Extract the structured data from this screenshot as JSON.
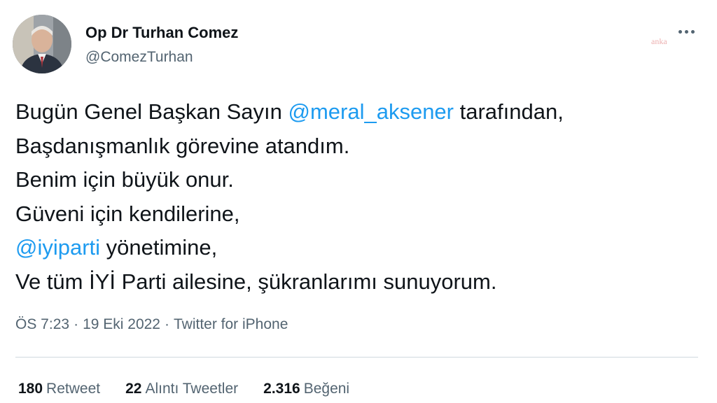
{
  "user": {
    "display_name": "Op Dr Turhan Comez",
    "handle": "@ComezTurhan"
  },
  "watermark": "anka",
  "tweet": {
    "lines": [
      {
        "before": "Bugün Genel Başkan Sayın ",
        "mention": "@meral_aksener",
        "after": " tarafından,"
      },
      {
        "text": "Başdanışmanlık görevine atandım."
      },
      {
        "text": "Benim için büyük onur."
      },
      {
        "text": "Güveni için kendilerine,"
      },
      {
        "mention": "@iyiparti",
        "after": " yönetimine,"
      },
      {
        "text": "Ve tüm İYİ Parti ailesine, şükranlarımı sunuyorum."
      }
    ]
  },
  "meta": {
    "time": "ÖS 7:23",
    "separator": "·",
    "date": "19 Eki 2022",
    "source": "Twitter for iPhone"
  },
  "stats": {
    "retweets": {
      "count": "180",
      "label": "Retweet"
    },
    "quotes": {
      "count": "22",
      "label": "Alıntı Tweetler"
    },
    "likes": {
      "count": "2.316",
      "label": "Beğeni"
    }
  },
  "colors": {
    "mention": "#1d9bf0",
    "secondary_text": "#536471",
    "primary_text": "#0f1419",
    "divider": "#cfd9de"
  },
  "icons": {
    "more": "more-horizontal-icon",
    "avatar": "profile-photo"
  }
}
